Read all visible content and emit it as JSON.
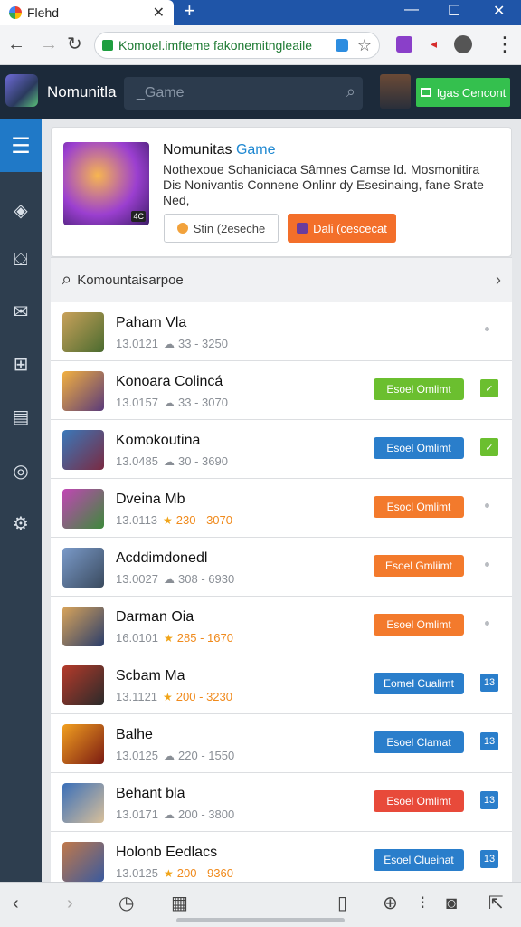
{
  "browser": {
    "tab_title": "Flehd",
    "tab_close": "✕",
    "new_tab": "+",
    "window": {
      "minimize": "—",
      "maximize": "☐",
      "close": "✕"
    },
    "url": "Komoel.imfteme fakonemitngleaile",
    "nav": {
      "back": "←",
      "forward": "→",
      "reload": "↻"
    },
    "star": "☆",
    "menu": "⋮"
  },
  "header": {
    "app_name": "Nomunitla",
    "search_placeholder": "_Game",
    "search_icon": "⌕",
    "cta_label": "Igas Cencont"
  },
  "sidebar": {
    "menu_glyph": "☰",
    "icons": [
      {
        "name": "layers-icon",
        "glyph": "◈"
      },
      {
        "name": "bag-icon",
        "glyph": "⛋"
      },
      {
        "name": "mail-icon",
        "glyph": "✉"
      },
      {
        "name": "gamepad-icon",
        "glyph": "⊞"
      },
      {
        "name": "document-icon",
        "glyph": "▤"
      },
      {
        "name": "camera-icon",
        "glyph": "◎"
      },
      {
        "name": "settings-icon",
        "glyph": "⚙"
      }
    ]
  },
  "hero": {
    "title": "Nomunitas",
    "title_accent": "Game",
    "description": "Nothexoue Sohaniciaca Sâmnes Camse ld. Mosmonitira Dis Nonivantis Connene Onlinr dy Esesinaing, fane Srate Ned,",
    "button1": "Stin (2eseche",
    "button2": "Dali (cescecat",
    "art_badge": "4C"
  },
  "list_search": {
    "icon": "⌕",
    "text": "Komountaisarpoe",
    "chevron": "›"
  },
  "games": [
    {
      "name": "Paham Vla",
      "id": "13.0121",
      "meta_icon": "☁",
      "stat": "33",
      "range": "3250",
      "style": "plain",
      "action": null,
      "badge": null,
      "colors": [
        "#c9a15a",
        "#4a6b2f"
      ]
    },
    {
      "name": "Konoara Colincá",
      "id": "13.0157",
      "meta_icon": "☁",
      "stat": "33",
      "range": "3070",
      "style": "plain",
      "action": "Esoel Omlimt",
      "action_color": "#6bbf2f",
      "badge": "✓",
      "badge_color": "#6bbf2f",
      "colors": [
        "#f2b040",
        "#5a3a7a"
      ]
    },
    {
      "name": "Komokoutina",
      "id": "13.0485",
      "meta_icon": "☁",
      "stat": "30",
      "range": "3690",
      "style": "plain",
      "action": "Esoel Omlimt",
      "action_color": "#2a7ecb",
      "badge": "✓",
      "badge_color": "#6bbf2f",
      "colors": [
        "#3a78b9",
        "#7a2a42"
      ]
    },
    {
      "name": "Dveina Mb",
      "id": "13.0113",
      "meta_icon": "★",
      "stat": "230",
      "range": "3070",
      "style": "star",
      "action": "Esocl Omlimt",
      "action_color": "#f37a2c",
      "badge": null,
      "colors": [
        "#c245b5",
        "#3c8a3a"
      ]
    },
    {
      "name": "Acddimdonedl",
      "id": "13.0027",
      "meta_icon": "☁",
      "stat": "308",
      "range": "6930",
      "style": "plain",
      "action": "Esoel Gmliimt",
      "action_color": "#f37a2c",
      "badge": null,
      "colors": [
        "#7a9ac9",
        "#3a4a5e"
      ]
    },
    {
      "name": "Darman Oia",
      "id": "16.0101",
      "meta_icon": "★",
      "stat": "285",
      "range": "1670",
      "style": "star",
      "action": "Esoel Omlimt",
      "action_color": "#f37a2c",
      "badge": null,
      "colors": [
        "#d9a45a",
        "#2a3d6b"
      ]
    },
    {
      "name": "Scbam Ma",
      "id": "13.1121",
      "meta_icon": "★",
      "stat": "200",
      "range": "3230",
      "style": "star",
      "action": "Eomel Cualimt",
      "action_color": "#2a7ecb",
      "badge": "13",
      "badge_color": "#2a7ecb",
      "colors": [
        "#b53a2a",
        "#2a2a2a"
      ]
    },
    {
      "name": "Balhe",
      "id": "13.0125",
      "meta_icon": "☁",
      "stat": "220",
      "range": "1550",
      "style": "plain",
      "action": "Esoel Clamat",
      "action_color": "#2a7ecb",
      "badge": "13",
      "badge_color": "#2a7ecb",
      "colors": [
        "#f2a020",
        "#7a1a12"
      ]
    },
    {
      "name": "Behant bla",
      "id": "13.0171",
      "meta_icon": "☁",
      "stat": "200",
      "range": "3800",
      "style": "plain",
      "action": "Esoel Omlimt",
      "action_color": "#e84a3a",
      "badge": "13",
      "badge_color": "#2a7ecb",
      "colors": [
        "#3a6fb9",
        "#d9c09a"
      ]
    },
    {
      "name": "Holonb Eedlacs",
      "id": "13.0125",
      "meta_icon": "★",
      "stat": "200",
      "range": "9360",
      "style": "star",
      "action": "Esoel Clueinat",
      "action_color": "#2a7ecb",
      "badge": "13",
      "badge_color": "#2a7ecb",
      "colors": [
        "#c0784a",
        "#3a5a9e"
      ]
    }
  ],
  "bottombar": {
    "icons": [
      {
        "name": "back-icon",
        "glyph": "‹"
      },
      {
        "name": "forward-icon",
        "glyph": "›"
      },
      {
        "name": "clock-icon",
        "glyph": "◷"
      },
      {
        "name": "grid-icon",
        "glyph": "▦"
      },
      {
        "name": "phone-icon",
        "glyph": "▯"
      },
      {
        "name": "add-icon",
        "glyph": "⊕"
      },
      {
        "name": "more-icon",
        "glyph": "⁝"
      },
      {
        "name": "camera-icon",
        "glyph": "◙"
      },
      {
        "name": "share-icon",
        "glyph": "⇱"
      }
    ]
  }
}
